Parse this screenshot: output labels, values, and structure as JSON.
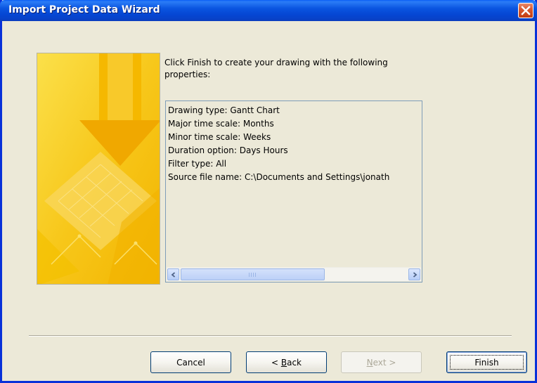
{
  "window": {
    "title": "Import Project Data Wizard",
    "close_icon": "close-icon"
  },
  "intro": {
    "text": "Click Finish to create your drawing with the following properties:"
  },
  "properties": {
    "lines": [
      "Drawing type:  Gantt Chart",
      "Major time scale:  Months",
      "Minor time scale:  Weeks",
      "Duration option: Days Hours",
      "Filter type:  All",
      "Source file name:  C:\\Documents and Settings\\jonath"
    ]
  },
  "buttons": {
    "cancel": "Cancel",
    "back_mnemonic": "B",
    "back_rest": "ack",
    "back_prefix": "< ",
    "next_mnemonic": "N",
    "next_rest": "ext >",
    "finish": "Finish"
  },
  "colors": {
    "title_bar": "#0a55e0",
    "dialog_bg": "#ece9d8",
    "accent_art": "#f5c400",
    "close_button": "#d85a32"
  }
}
